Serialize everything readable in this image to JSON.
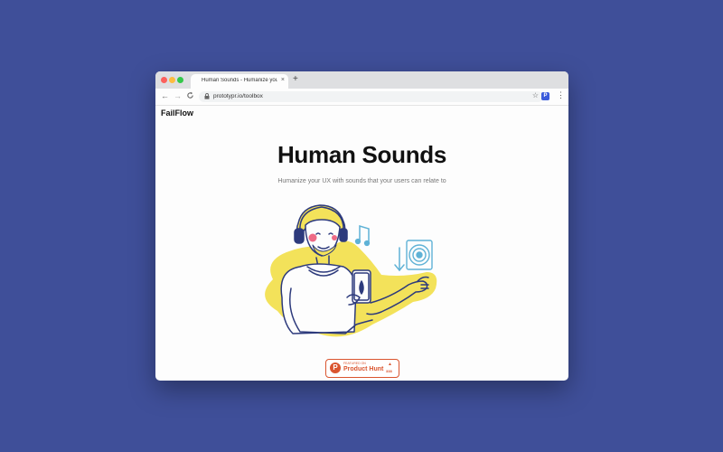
{
  "browser": {
    "tab_title": "Human Sounds - Humanize your",
    "tab_close": "×",
    "new_tab": "+",
    "back": "←",
    "forward": "→",
    "reload": "C",
    "lock": "🔒",
    "url": "prototypr.io/toolbox",
    "star": "☆",
    "extension_label": "P",
    "menu": "⋮"
  },
  "page": {
    "brand": "FailFlow",
    "title": "Human Sounds",
    "subtitle": "Humanize your UX with sounds that your users can relate to"
  },
  "product_hunt": {
    "logo": "P",
    "small": "Featured on",
    "label": "Product Hunt",
    "arrow": "▲",
    "count": "338"
  },
  "colors": {
    "background": "#3f4f99",
    "accent_yellow": "#f3e25a",
    "ink_navy": "#2d3a7c",
    "music_blue": "#5fb2d6",
    "product_hunt": "#da552f"
  },
  "icons": [
    "lock-icon",
    "star-icon",
    "kebab-menu-icon",
    "music-note-icon",
    "down-arrow-icon",
    "speaker-icon",
    "product-hunt-logo"
  ]
}
